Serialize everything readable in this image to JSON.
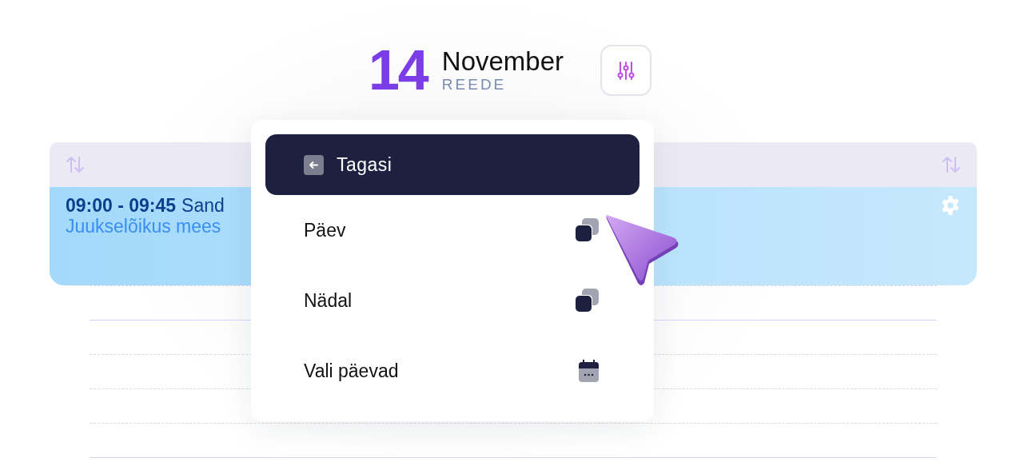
{
  "header": {
    "day": "14",
    "month": "November",
    "weekday": "REEDE"
  },
  "event": {
    "time": "09:00 - 09:45",
    "client": "Sand",
    "service": "Juukselõikus mees"
  },
  "menu": {
    "items": [
      {
        "kind": "back",
        "label": "Tagasi"
      },
      {
        "kind": "view",
        "label": "Päev"
      },
      {
        "kind": "view",
        "label": "Nädal"
      },
      {
        "kind": "pick",
        "label": "Vali päevad"
      }
    ]
  }
}
